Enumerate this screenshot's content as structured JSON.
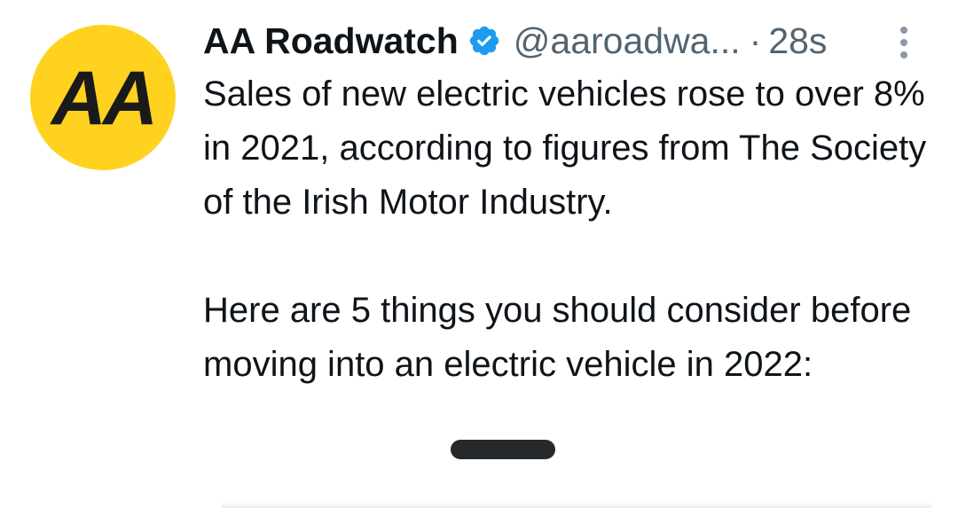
{
  "tweet": {
    "author_name": "AA Roadwatch",
    "handle": "@aaroadwa...",
    "separator": "·",
    "timestamp": "28s",
    "avatar_text": "AA",
    "paragraphs": [
      "Sales of new electric vehicles rose to over 8% in 2021, according to figures from The Society of the Irish Motor Industry.",
      "Here are 5 things you should consider before moving into an electric vehicle in 2022:"
    ]
  },
  "icons": {
    "verified": "verified-badge-icon",
    "more": "more-options-icon"
  },
  "colors": {
    "avatar_bg": "#ffd21f",
    "verified_blue": "#1d9bf0",
    "secondary_text": "#536471",
    "primary_text": "#0f1419"
  }
}
